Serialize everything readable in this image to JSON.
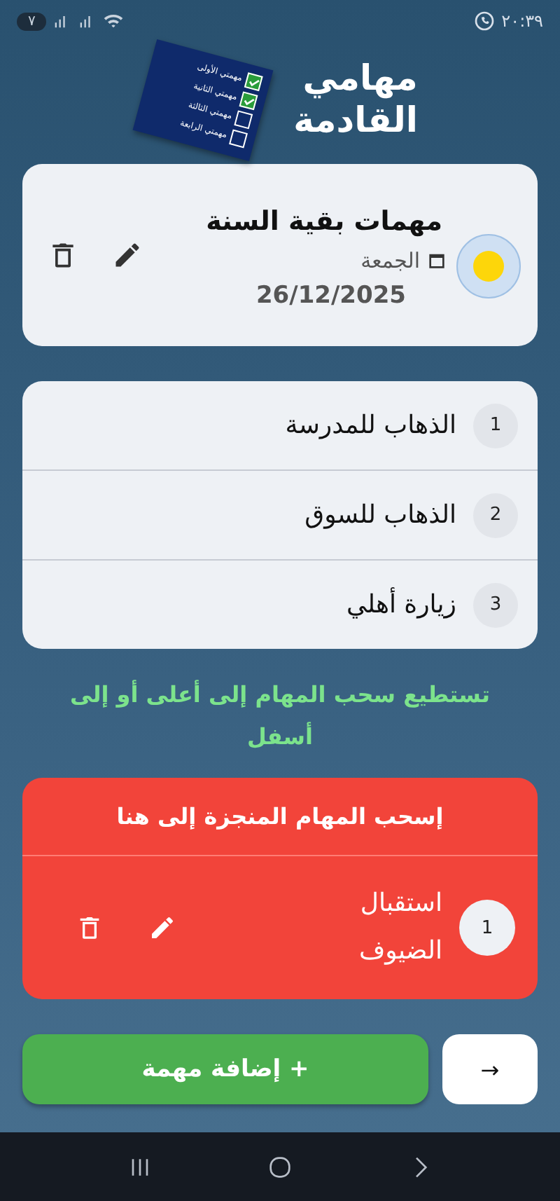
{
  "status_bar": {
    "time": "٢٠:٣٩",
    "battery": "٧"
  },
  "header": {
    "title_lines": [
      "مهامي",
      "القادمة"
    ],
    "logo_items": [
      {
        "label": "مهمتي الأولى",
        "checked": true
      },
      {
        "label": "مهمتي الثانية",
        "checked": true
      },
      {
        "label": "مهمتي الثالثة",
        "checked": false
      },
      {
        "label": "مهمتي الرابعة",
        "checked": false
      }
    ]
  },
  "event": {
    "title": "مهمات بقية السنة",
    "day": "الجمعة",
    "date": "26/12/2025",
    "color": "#fdd60a"
  },
  "tasks": [
    {
      "number": "1",
      "title": "الذهاب للمدرسة"
    },
    {
      "number": "2",
      "title": "الذهاب للسوق"
    },
    {
      "number": "3",
      "title": "زيارة أهلي"
    }
  ],
  "hint": "تستطيع سحب المهام إلى أعلى أو إلى أسفل",
  "done_zone": {
    "title": "إسحب المهام المنجزة إلى هنا",
    "tasks": [
      {
        "number": "1",
        "title": "استقبال الضيوف"
      }
    ]
  },
  "buttons": {
    "add": "+ إضافة مهمة",
    "next": "→"
  }
}
